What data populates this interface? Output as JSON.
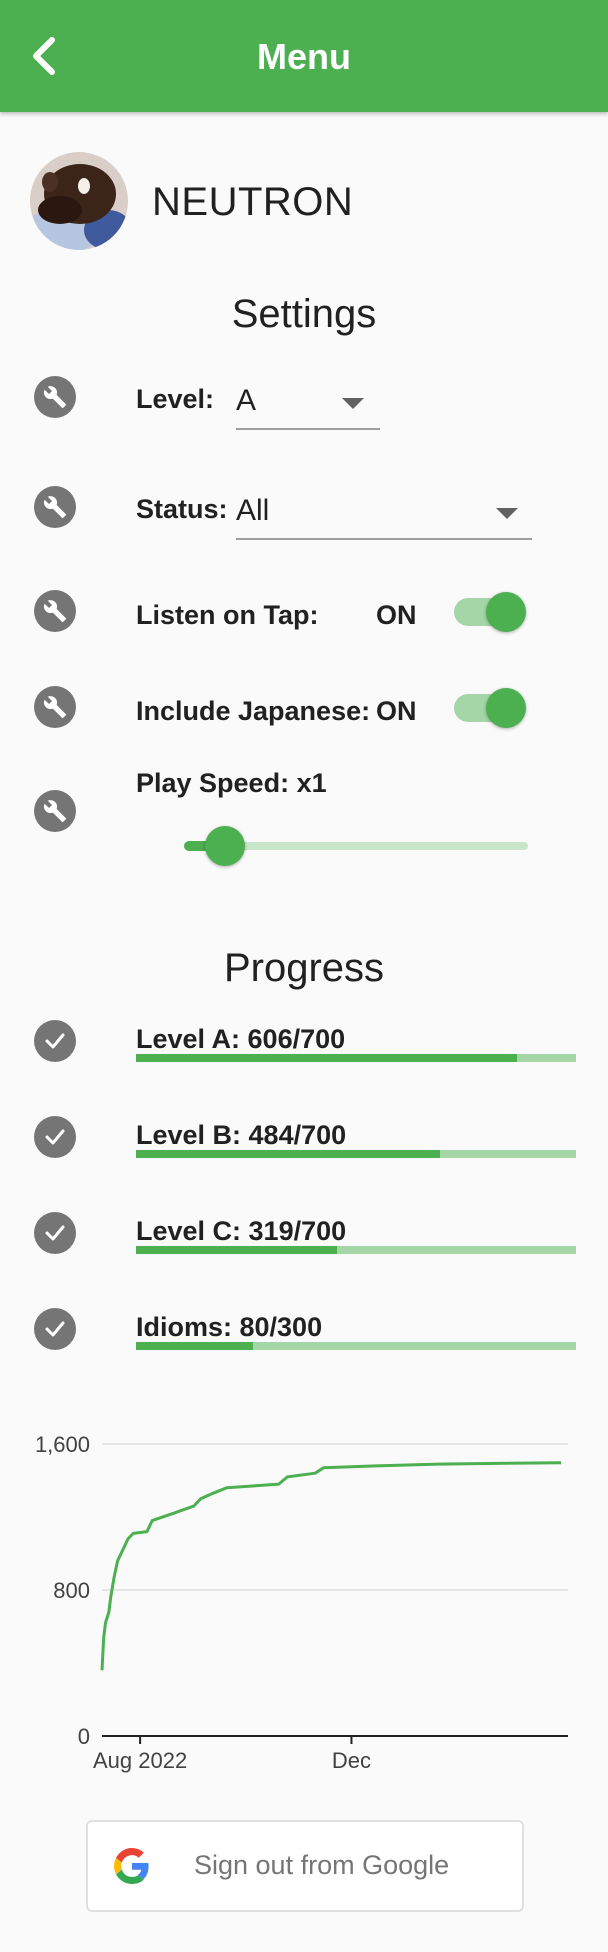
{
  "header": {
    "title": "Menu",
    "back_icon": "chevron-left-icon"
  },
  "profile": {
    "name": "NEUTRON"
  },
  "settings": {
    "title": "Settings",
    "level": {
      "label": "Level:",
      "value": "A"
    },
    "status": {
      "label": "Status:",
      "value": "All"
    },
    "listen_on_tap": {
      "label": "Listen on Tap:",
      "value": "ON",
      "on": true
    },
    "include_japanese": {
      "label": "Include Japanese:",
      "value": "ON",
      "on": true
    },
    "play_speed": {
      "label": "Play Speed: x1",
      "fraction": 0.12
    }
  },
  "progress": {
    "title": "Progress",
    "items": [
      {
        "label": "Level A: 606/700",
        "value": 606,
        "total": 700
      },
      {
        "label": "Level B: 484/700",
        "value": 484,
        "total": 700
      },
      {
        "label": "Level C: 319/700",
        "value": 319,
        "total": 700
      },
      {
        "label": "Idioms: 80/300",
        "value": 80,
        "total": 300
      }
    ]
  },
  "chart_data": {
    "type": "line",
    "title": "",
    "xlabel": "",
    "ylabel": "",
    "ylim": [
      0,
      1600
    ],
    "yticks": [
      "1,600",
      "800",
      "0"
    ],
    "xticks": [
      "Aug 2022",
      "Dec"
    ],
    "grid": true,
    "series": [
      {
        "color": "#4caf50",
        "points": [
          [
            "2022-07-10",
            360
          ],
          [
            "2022-07-11",
            540
          ],
          [
            "2022-07-12",
            620
          ],
          [
            "2022-07-14",
            680
          ],
          [
            "2022-07-15",
            760
          ],
          [
            "2022-07-17",
            870
          ],
          [
            "2022-07-19",
            960
          ],
          [
            "2022-07-22",
            1020
          ],
          [
            "2022-07-25",
            1080
          ],
          [
            "2022-07-28",
            1110
          ],
          [
            "2022-08-05",
            1120
          ],
          [
            "2022-08-08",
            1180
          ],
          [
            "2022-08-20",
            1220
          ],
          [
            "2022-09-01",
            1260
          ],
          [
            "2022-09-05",
            1300
          ],
          [
            "2022-09-12",
            1330
          ],
          [
            "2022-09-20",
            1360
          ],
          [
            "2022-10-05",
            1370
          ],
          [
            "2022-10-20",
            1380
          ],
          [
            "2022-10-25",
            1420
          ],
          [
            "2022-11-10",
            1440
          ],
          [
            "2022-11-15",
            1470
          ],
          [
            "2022-12-15",
            1480
          ],
          [
            "2023-01-20",
            1490
          ],
          [
            "2023-03-01",
            1495
          ],
          [
            "2023-04-01",
            1497
          ]
        ]
      }
    ]
  },
  "signout": {
    "label": "Sign out from Google",
    "icon": "google-icon"
  }
}
